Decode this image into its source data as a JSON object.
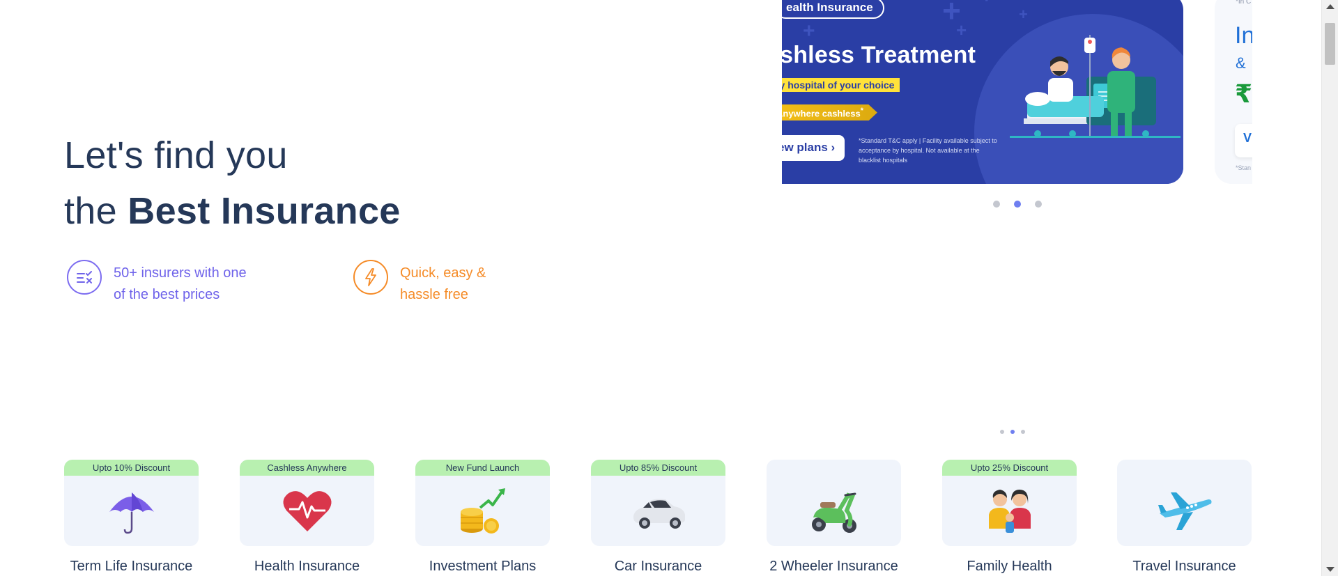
{
  "hero": {
    "line1": "Let's find you",
    "line2_prefix": "the ",
    "line2_bold": "Best Insurance"
  },
  "features": [
    {
      "line1": "50+ insurers with one",
      "line2": "of the best prices",
      "icon": "compare-list-icon",
      "color": "#6f63ea"
    },
    {
      "line1": "Quick, easy &",
      "line2": "hassle free",
      "icon": "lightning-icon",
      "color": "#f58b27"
    }
  ],
  "carousel": {
    "active_banner": {
      "tag": "ealth Insurance",
      "small_tag": "t",
      "headline": "ashless Treatment",
      "highlight": "ny hospital of your choice",
      "ribbon": "Anywhere cashless",
      "ribbon_sup": "*",
      "cta": "ew plans",
      "disclaimer": "*Standard T&C apply | Facility available subject to acceptance by hospital. Not available at the blacklist hospitals",
      "background": "#2a3ea5"
    },
    "next_banner": {
      "small_text": "*In C the p",
      "big_text": "In",
      "amp": "&",
      "rupee": "₹",
      "button": "V",
      "footnote": "*Stan"
    },
    "dots_count": 3,
    "active_dot": 2
  },
  "products": [
    {
      "name": "Term Life Insurance",
      "badge": "Upto 10% Discount",
      "icon": "umbrella-icon"
    },
    {
      "name": "Health Insurance",
      "badge": "Cashless Anywhere",
      "icon": "heart-pulse-icon"
    },
    {
      "name": "Investment Plans",
      "badge": "New Fund Launch",
      "icon": "coins-growth-icon"
    },
    {
      "name": "Car Insurance",
      "badge": "Upto 85% Discount",
      "icon": "car-icon"
    },
    {
      "name": "2 Wheeler Insurance",
      "badge": "",
      "icon": "scooter-icon"
    },
    {
      "name": "Family Health",
      "badge": "Upto 25% Discount",
      "icon": "family-icon"
    },
    {
      "name": "Travel Insurance",
      "badge": "",
      "icon": "airplane-icon"
    }
  ],
  "colors": {
    "heading": "#253858",
    "badge_bg": "#b8f0b0",
    "card_bg": "#f0f4fb",
    "dot_active": "#6f7ff0"
  }
}
